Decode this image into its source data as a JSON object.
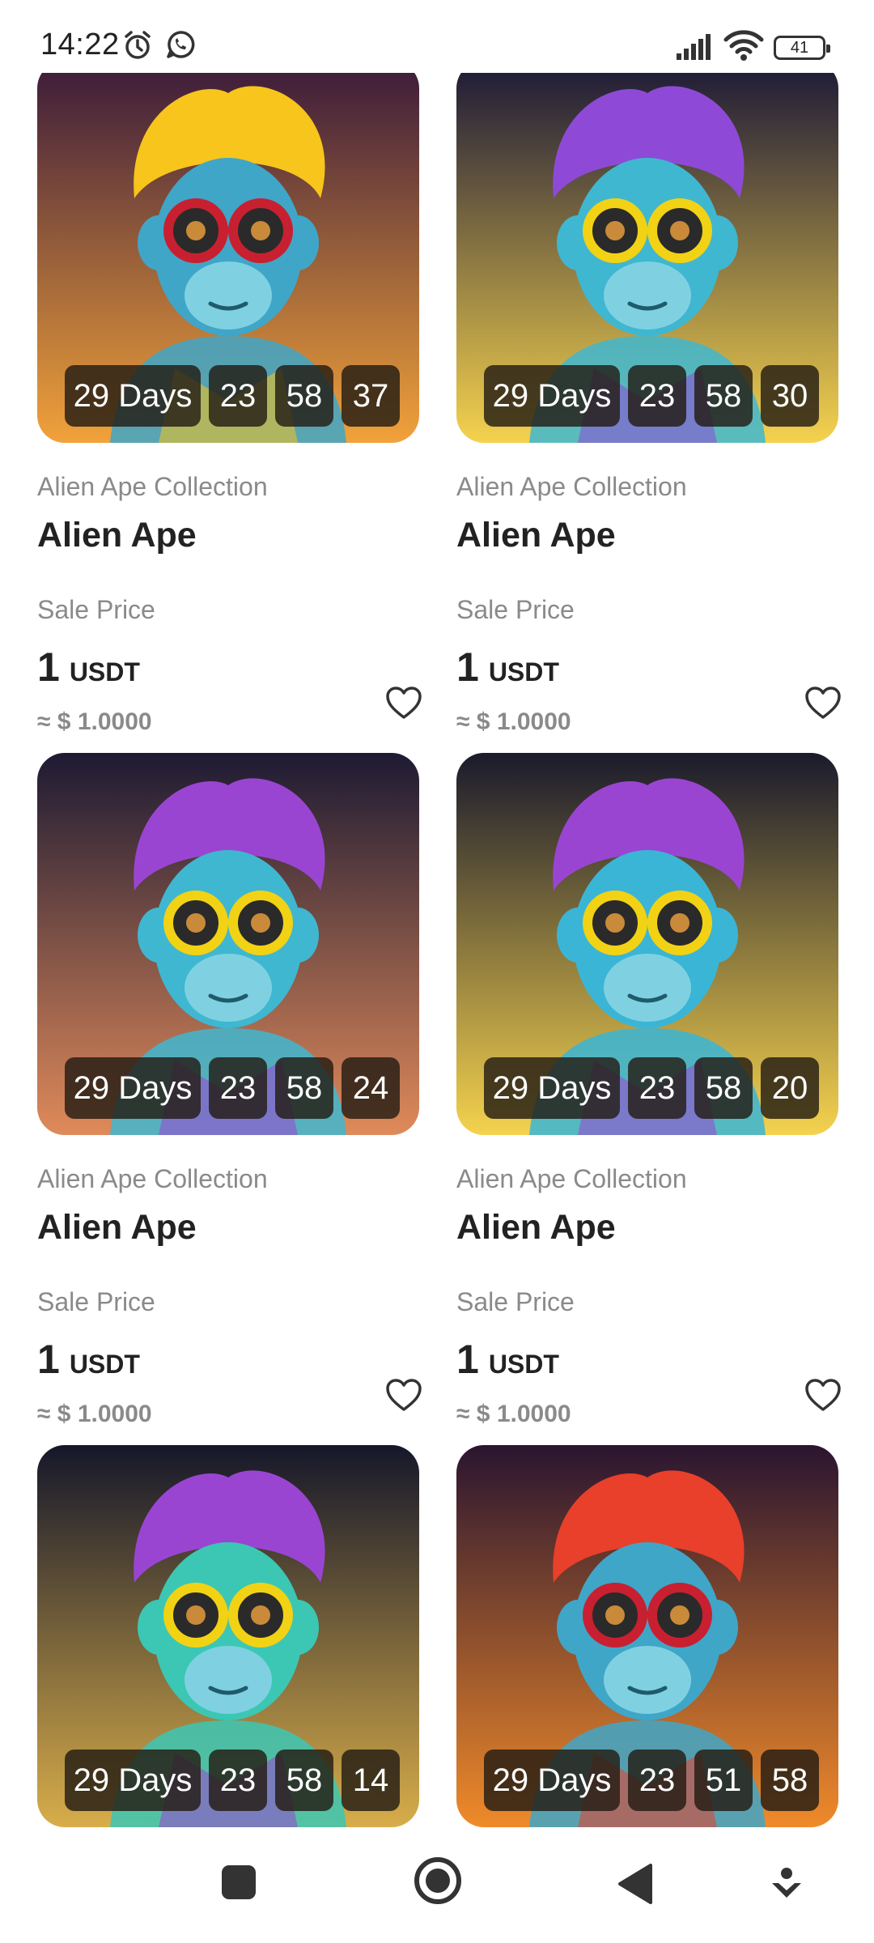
{
  "status_bar": {
    "time": "14:22",
    "battery": "41",
    "icons": [
      "alarm-icon",
      "whatsapp-icon",
      "signal-icon",
      "wifi-icon",
      "battery-icon"
    ]
  },
  "cards": [
    {
      "collection": "Alien Ape Collection",
      "title": "Alien Ape",
      "sale_label": "Sale Price",
      "price": "1",
      "unit": "USDT",
      "approx": "≈ $ 1.0000",
      "countdown": {
        "days": "29 Days",
        "hours": "23",
        "minutes": "58",
        "seconds": "37"
      }
    },
    {
      "collection": "Alien Ape Collection",
      "title": "Alien Ape",
      "sale_label": "Sale Price",
      "price": "1",
      "unit": "USDT",
      "approx": "≈ $ 1.0000",
      "countdown": {
        "days": "29 Days",
        "hours": "23",
        "minutes": "58",
        "seconds": "30"
      }
    },
    {
      "collection": "Alien Ape Collection",
      "title": "Alien Ape",
      "sale_label": "Sale Price",
      "price": "1",
      "unit": "USDT",
      "approx": "≈ $ 1.0000",
      "countdown": {
        "days": "29 Days",
        "hours": "23",
        "minutes": "58",
        "seconds": "24"
      }
    },
    {
      "collection": "Alien Ape Collection",
      "title": "Alien Ape",
      "sale_label": "Sale Price",
      "price": "1",
      "unit": "USDT",
      "approx": "≈ $ 1.0000",
      "countdown": {
        "days": "29 Days",
        "hours": "23",
        "minutes": "58",
        "seconds": "20"
      }
    },
    {
      "collection": "",
      "title": "",
      "sale_label": "",
      "price": "",
      "unit": "",
      "approx": "",
      "countdown": {
        "days": "29 Days",
        "hours": "23",
        "minutes": "58",
        "seconds": "14"
      }
    },
    {
      "collection": "",
      "title": "",
      "sale_label": "",
      "price": "",
      "unit": "",
      "approx": "",
      "countdown": {
        "days": "29 Days",
        "hours": "23",
        "minutes": "51",
        "seconds": "58"
      }
    }
  ],
  "nav_bar": {
    "buttons": [
      "recents-button",
      "home-button",
      "back-button",
      "assistant-button"
    ]
  },
  "colors": {
    "text_primary": "#222222",
    "text_secondary": "#8a8a8a",
    "countdown_bg": "#231c14"
  }
}
